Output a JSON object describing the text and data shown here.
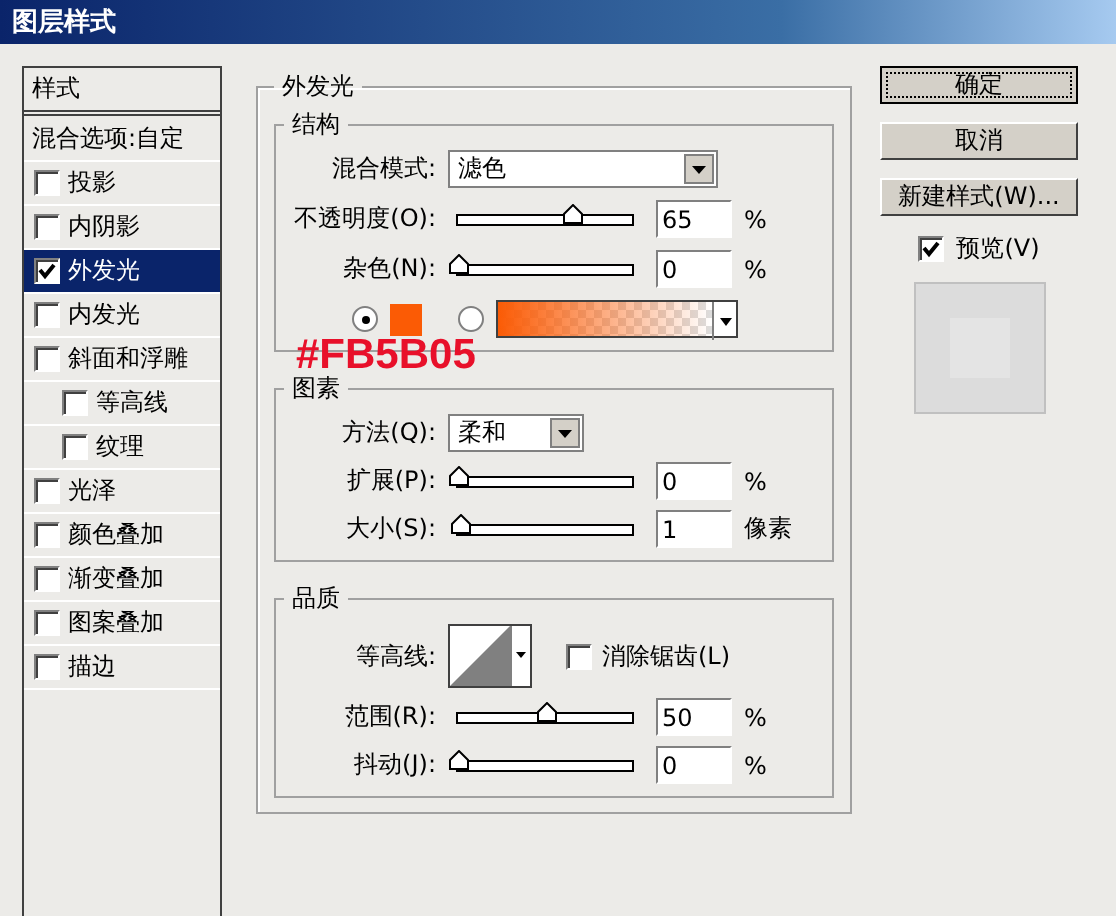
{
  "window": {
    "title": "图层样式"
  },
  "styles_list": {
    "header": "样式",
    "blend_options": "混合选项:自定",
    "items": [
      {
        "label": "投影",
        "checked": false,
        "selected": false
      },
      {
        "label": "内阴影",
        "checked": false,
        "selected": false
      },
      {
        "label": "外发光",
        "checked": true,
        "selected": true
      },
      {
        "label": "内发光",
        "checked": false,
        "selected": false
      },
      {
        "label": "斜面和浮雕",
        "checked": false,
        "selected": false,
        "children": [
          {
            "label": "等高线",
            "checked": false,
            "selected": false
          },
          {
            "label": "纹理",
            "checked": false,
            "selected": false
          }
        ]
      },
      {
        "label": "光泽",
        "checked": false,
        "selected": false
      },
      {
        "label": "颜色叠加",
        "checked": false,
        "selected": false
      },
      {
        "label": "渐变叠加",
        "checked": false,
        "selected": false
      },
      {
        "label": "图案叠加",
        "checked": false,
        "selected": false
      },
      {
        "label": "描边",
        "checked": false,
        "selected": false
      }
    ]
  },
  "panel": {
    "title": "外发光",
    "sections": [
      {
        "title": "结构",
        "rows": [
          {
            "kind": "dropdown",
            "label": "混合模式:",
            "value": "滤色"
          },
          {
            "kind": "slider",
            "label": "不透明度(O):",
            "level": 0.65,
            "value": "65",
            "unit": "%"
          },
          {
            "kind": "slider",
            "label": "杂色(N):",
            "level": 0,
            "value": "0",
            "unit": "%"
          },
          {
            "kind": "color",
            "options": [
              {
                "kind": "swatch",
                "selected": true,
                "color": "#fb5b05"
              },
              {
                "kind": "gradient",
                "selected": false,
                "color": "#fb5b05"
              }
            ]
          }
        ]
      },
      {
        "title": "图素",
        "rows": [
          {
            "kind": "dropdown",
            "label": "方法(Q):",
            "value": "柔和"
          },
          {
            "kind": "slider",
            "label": "扩展(P):",
            "level": 0,
            "value": "0",
            "unit": "%"
          },
          {
            "kind": "slider",
            "label": "大小(S):",
            "level": 0.01,
            "value": "1",
            "unit": "像素"
          }
        ]
      },
      {
        "title": "品质",
        "rows": [
          {
            "kind": "contour",
            "label": "等高线:",
            "checkbox": {
              "label": "消除锯齿(L)",
              "checked": false
            }
          },
          {
            "kind": "slider",
            "label": "范围(R):",
            "level": 0.5,
            "value": "50",
            "unit": "%"
          },
          {
            "kind": "slider",
            "label": "抖动(J):",
            "level": 0,
            "value": "0",
            "unit": "%"
          }
        ]
      }
    ]
  },
  "buttons": [
    {
      "label": "确定",
      "default": true
    },
    {
      "label": "取消",
      "default": false
    },
    {
      "label": "新建样式(W)...",
      "default": false
    }
  ],
  "preview": {
    "label": "预览(V)",
    "checked": true
  },
  "annotation": {
    "text": "#FB5B05"
  }
}
